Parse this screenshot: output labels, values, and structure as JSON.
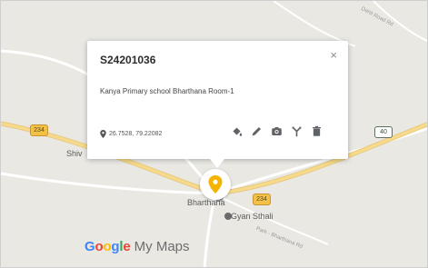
{
  "map": {
    "places": {
      "shiv": "Shiv",
      "bharthana": "Bharthana",
      "gyan_sthali": "Gyan Sthali"
    },
    "road_labels": {
      "top_right": "Dehli Road Rd",
      "bottom": "Park - Bharthana Rd"
    },
    "route_shields": {
      "left": "234",
      "center": "234",
      "right": "40"
    }
  },
  "info_card": {
    "title": "S24201036",
    "close_glyph": "×",
    "description": "Kanya Primary school Bharthana Room-1",
    "coordinates": "26.7528, 79.22082"
  },
  "branding": {
    "google_letters": [
      "G",
      "o",
      "o",
      "g",
      "l",
      "e"
    ],
    "google_colors": [
      "#4285F4",
      "#EA4335",
      "#FBBC05",
      "#4285F4",
      "#34A853",
      "#EA4335"
    ],
    "product": "My Maps"
  },
  "colors": {
    "pin": "#f4b400",
    "major_road": "#f6d98a",
    "highway": "#ffffff"
  }
}
